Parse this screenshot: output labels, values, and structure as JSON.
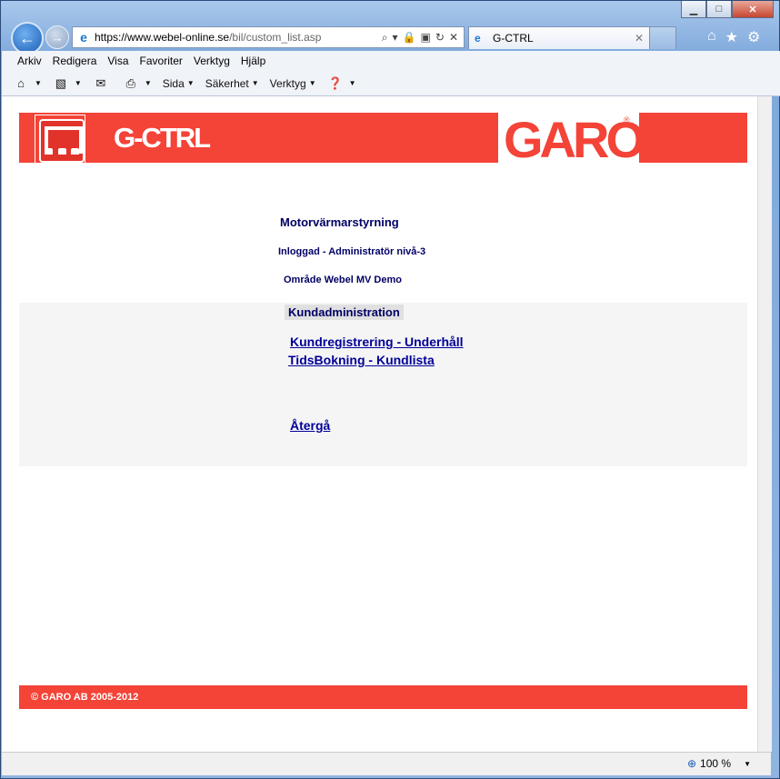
{
  "browser": {
    "url_host": "https://www.webel-online.se",
    "url_path": "/bil/custom_list.asp",
    "tab_title": "G-CTRL",
    "menu": [
      "Arkiv",
      "Redigera",
      "Visa",
      "Favoriter",
      "Verktyg",
      "Hjälp"
    ],
    "commands": [
      "Sida",
      "Säkerhet",
      "Verktyg"
    ],
    "zoom": "100 %"
  },
  "header": {
    "app_logo": "G-CTRL",
    "brand_logo": "GARO",
    "brand_reg": "®"
  },
  "page": {
    "title": "Motorvärmarstyrning",
    "logged_in": "Inloggad - Administratör nivå-3",
    "area": "Område Webel MV Demo",
    "section": "Kundadministration",
    "links": {
      "customer_registration": "Kundregistrering - Underhåll",
      "time_booking": "TidsBokning - Kundlista",
      "back": "Återgå"
    }
  },
  "footer": {
    "copyright": "© GARO AB 2005-2012"
  },
  "colors": {
    "brand_red": "#f44337",
    "text_navy": "#000066",
    "link_blue": "#000099"
  }
}
